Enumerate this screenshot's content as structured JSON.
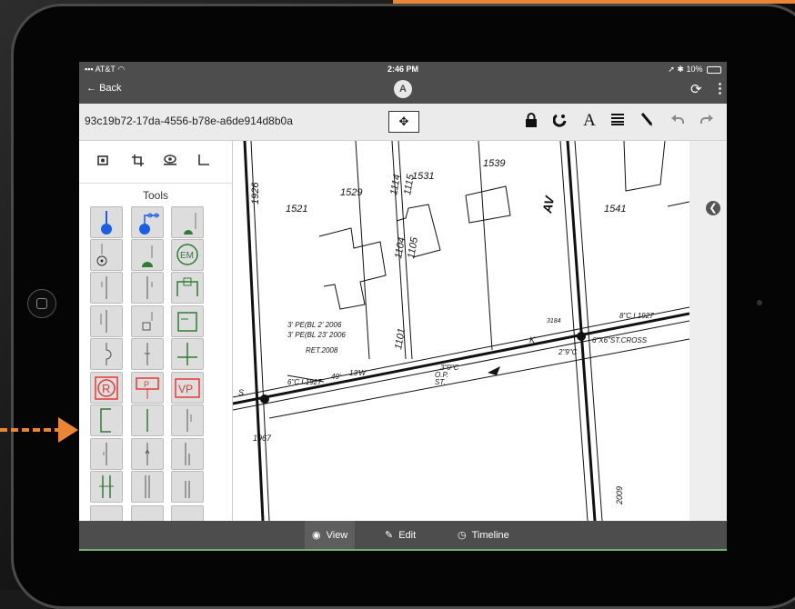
{
  "status": {
    "carrier": "AT&T",
    "time": "2:46 PM",
    "battery": "10%"
  },
  "nav": {
    "back_label": "Back",
    "logo_letter": "A"
  },
  "toolbar": {
    "doc_id": "93c19b72-17da-4556-b78e-a6de914d8b0a"
  },
  "tools": {
    "title": "Tools"
  },
  "map": {
    "labels": [
      "1521",
      "1529",
      "1531",
      "1539",
      "1541",
      "1114",
      "1115",
      "1104",
      "1105",
      "1101",
      "1926",
      "1967",
      "2009",
      "3184",
      "AV",
      "RET.2008",
      "3' PE(BL 2' 2006",
      "3' PE(BL 23' 2006",
      "6\"C.I.1927",
      "8\"C.I.1927",
      "2\"9\"C",
      "3\"0\"C",
      "6\"X6\"ST.CROSS",
      "ST.",
      "O.P.",
      "49'",
      "13'W",
      "S",
      "K"
    ]
  },
  "bottom": {
    "tabs": [
      {
        "label": "View",
        "active": true
      },
      {
        "label": "Edit",
        "active": false
      },
      {
        "label": "Timeline",
        "active": false
      }
    ]
  },
  "colors": {
    "accent_orange": "#e98533",
    "bar_grey": "#4d4d4d",
    "tool_blue": "#1a5ee6",
    "tool_red": "#e53935",
    "tool_green": "#2e7d32"
  },
  "icons": [
    "wifi-icon",
    "back-arrow-icon",
    "refresh-icon",
    "kebab-menu-icon",
    "move-icon",
    "lock-icon",
    "magnet-icon",
    "text-icon",
    "lines-icon",
    "pen-icon",
    "undo-icon",
    "redo-icon",
    "camera-icon",
    "crop-icon",
    "eye-icon",
    "angle-icon",
    "collapse-icon",
    "eye-icon",
    "edit-icon",
    "clock-icon"
  ]
}
